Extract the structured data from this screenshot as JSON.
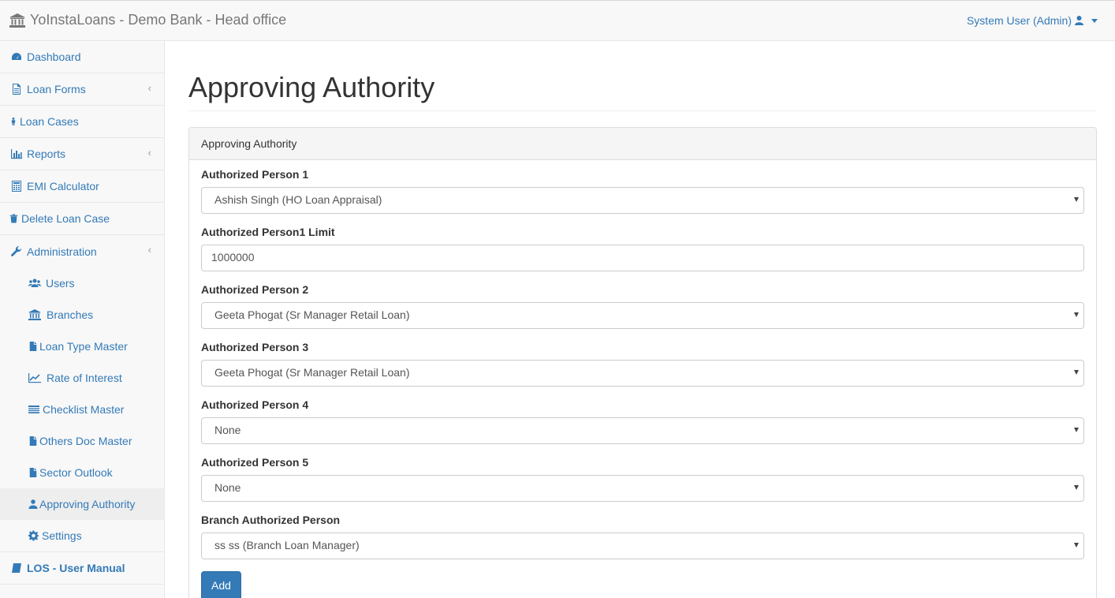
{
  "header": {
    "brand": "YoInstaLoans - Demo Bank - Head office",
    "user": "System User (Admin)"
  },
  "sidebar": {
    "items": [
      {
        "label": "Dashboard",
        "icon": "dashboard-icon"
      },
      {
        "label": "Loan Forms",
        "icon": "file-icon"
      },
      {
        "label": "Loan Cases",
        "icon": "person-icon"
      },
      {
        "label": "Reports",
        "icon": "bar-chart-icon"
      },
      {
        "label": "EMI Calculator",
        "icon": "calculator-icon"
      },
      {
        "label": "Delete Loan Case",
        "icon": "trash-icon"
      },
      {
        "label": "Administration",
        "icon": "wrench-icon"
      }
    ],
    "admin_items": [
      {
        "label": "Users",
        "icon": "users-icon"
      },
      {
        "label": "Branches",
        "icon": "bank-icon"
      },
      {
        "label": "Loan Type Master",
        "icon": "file-icon"
      },
      {
        "label": "Rate of Interest",
        "icon": "line-chart-icon"
      },
      {
        "label": "Checklist Master",
        "icon": "list-icon"
      },
      {
        "label": "Others Doc Master",
        "icon": "file-icon"
      },
      {
        "label": "Sector Outlook",
        "icon": "file-icon"
      },
      {
        "label": "Approving Authority",
        "icon": "user-icon"
      },
      {
        "label": "Settings",
        "icon": "gear-icon"
      }
    ],
    "manual": "LOS - User Manual"
  },
  "page": {
    "title": "Approving Authority",
    "panel_title": "Approving Authority"
  },
  "form": {
    "person1_label": "Authorized Person 1",
    "person1_value": "Ashish Singh (HO Loan Appraisal)",
    "limit1_label": "Authorized Person1 Limit",
    "limit1_value": "1000000",
    "person2_label": "Authorized Person 2",
    "person2_value": "Geeta Phogat (Sr Manager Retail Loan)",
    "person3_label": "Authorized Person 3",
    "person3_value": "Geeta Phogat (Sr Manager Retail Loan)",
    "person4_label": "Authorized Person 4",
    "person4_value": "None",
    "person5_label": "Authorized Person 5",
    "person5_value": "None",
    "branch_label": "Branch Authorized Person",
    "branch_value": "ss ss (Branch Loan Manager)",
    "add_label": "Add"
  },
  "colors": {
    "link": "#337ab7",
    "button": "#337ab7"
  }
}
